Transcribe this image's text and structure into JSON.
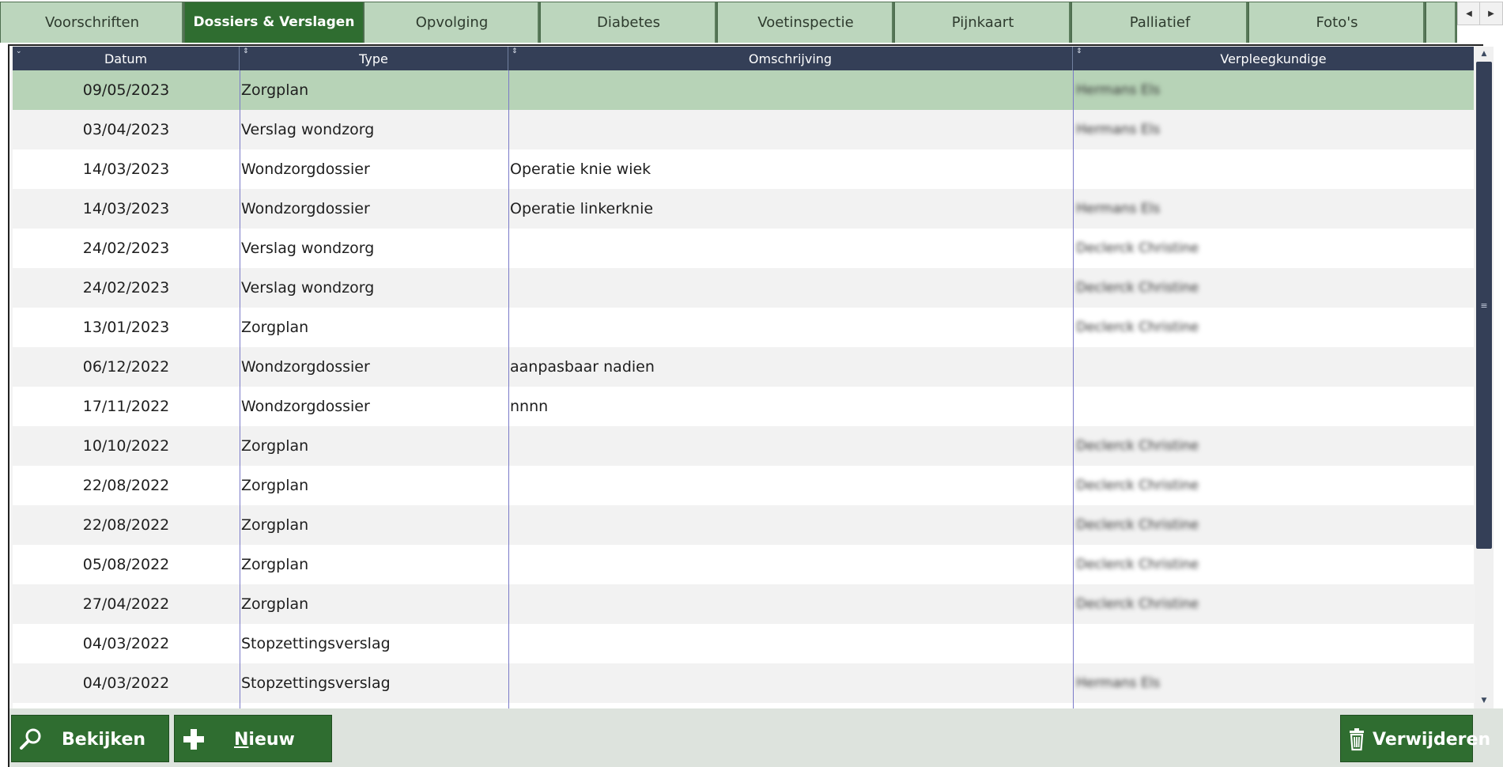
{
  "tabs": [
    {
      "label": "Voorschriften",
      "active": false
    },
    {
      "label": "Dossiers & Verslagen",
      "active": true
    },
    {
      "label": "Opvolging",
      "active": false
    },
    {
      "label": "Diabetes",
      "active": false
    },
    {
      "label": "Voetinspectie",
      "active": false
    },
    {
      "label": "Pijnkaart",
      "active": false
    },
    {
      "label": "Palliatief",
      "active": false
    },
    {
      "label": "Foto's",
      "active": false
    }
  ],
  "tab_scroll": {
    "left_icon": "triangle-left-icon",
    "right_icon": "triangle-right-icon"
  },
  "grid": {
    "columns": [
      "Datum",
      "Type",
      "Omschrijving",
      "Verpleegkundige"
    ],
    "rows": [
      {
        "date": "09/05/2023",
        "type": "Zorgplan",
        "description": "",
        "nurse": "Hermans Els",
        "selected": true
      },
      {
        "date": "03/04/2023",
        "type": "Verslag wondzorg",
        "description": "",
        "nurse": "Hermans Els"
      },
      {
        "date": "14/03/2023",
        "type": "Wondzorgdossier",
        "description": "Operatie knie wiek",
        "nurse": ""
      },
      {
        "date": "14/03/2023",
        "type": "Wondzorgdossier",
        "description": "Operatie linkerknie",
        "nurse": "Hermans Els"
      },
      {
        "date": "24/02/2023",
        "type": "Verslag wondzorg",
        "description": "",
        "nurse": "Declerck Christine"
      },
      {
        "date": "24/02/2023",
        "type": "Verslag wondzorg",
        "description": "",
        "nurse": "Declerck Christine"
      },
      {
        "date": "13/01/2023",
        "type": "Zorgplan",
        "description": "",
        "nurse": "Declerck Christine"
      },
      {
        "date": "06/12/2022",
        "type": "Wondzorgdossier",
        "description": "aanpasbaar nadien",
        "nurse": ""
      },
      {
        "date": "17/11/2022",
        "type": "Wondzorgdossier",
        "description": "nnnn",
        "nurse": ""
      },
      {
        "date": "10/10/2022",
        "type": "Zorgplan",
        "description": "",
        "nurse": "Declerck Christine"
      },
      {
        "date": "22/08/2022",
        "type": "Zorgplan",
        "description": "",
        "nurse": "Declerck Christine"
      },
      {
        "date": "22/08/2022",
        "type": "Zorgplan",
        "description": "",
        "nurse": "Declerck Christine"
      },
      {
        "date": "05/08/2022",
        "type": "Zorgplan",
        "description": "",
        "nurse": "Declerck Christine"
      },
      {
        "date": "27/04/2022",
        "type": "Zorgplan",
        "description": "",
        "nurse": "Declerck Christine"
      },
      {
        "date": "04/03/2022",
        "type": "Stopzettingsverslag",
        "description": "",
        "nurse": ""
      },
      {
        "date": "04/03/2022",
        "type": "Stopzettingsverslag",
        "description": "",
        "nurse": "Hermans Els"
      }
    ]
  },
  "actions": {
    "view": {
      "label": "Bekijken",
      "icon": "search-icon"
    },
    "new": {
      "label_underlined": "N",
      "label_rest": "ieuw",
      "icon": "plus-icon"
    },
    "delete": {
      "label": "Verwijderen",
      "icon": "trash-icon"
    }
  },
  "colors": {
    "tab_bg": "#bcd6bd",
    "tab_active_bg": "#2f6d30",
    "header_bg": "#343f57",
    "selected_row": "#b7d3b7",
    "button_bg": "#2f6d30"
  }
}
